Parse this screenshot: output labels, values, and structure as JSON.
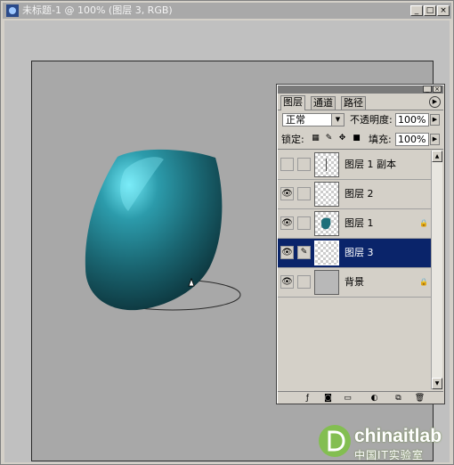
{
  "window": {
    "title": "未标题-1 @ 100% (图层 3, RGB)",
    "controls": [
      "_",
      "□",
      "×"
    ]
  },
  "panel": {
    "tabs": [
      "图层",
      "通道",
      "路径"
    ],
    "blend_mode": "正常",
    "opacity_label": "不透明度:",
    "opacity_value": "100%",
    "lock_label": "锁定:",
    "fill_label": "填充:",
    "fill_value": "100%",
    "layers": [
      {
        "name": "图层 1 副本",
        "visible": false,
        "selected": false,
        "locked": false
      },
      {
        "name": "图层 2",
        "visible": true,
        "selected": false,
        "locked": false
      },
      {
        "name": "图层 1",
        "visible": true,
        "selected": false,
        "locked": true
      },
      {
        "name": "图层 3",
        "visible": true,
        "selected": true,
        "locked": false
      },
      {
        "name": "背景",
        "visible": true,
        "selected": false,
        "locked": true
      }
    ]
  },
  "colors": {
    "selection": "#0a246a",
    "vase": "#1e6f7a",
    "canvas": "#a8a8a8"
  },
  "watermark": {
    "brand": "chinaitlab",
    "subtitle": "中国IT实验室"
  }
}
